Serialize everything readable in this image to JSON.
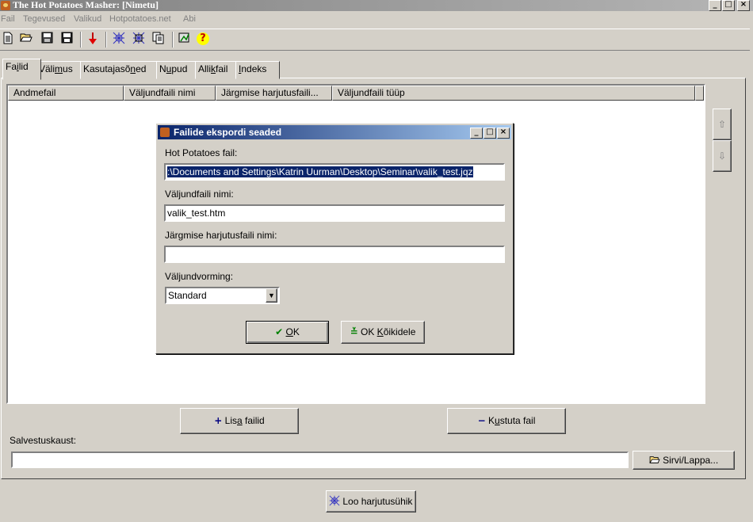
{
  "window": {
    "title": "The Hot Potatoes Masher: [Nimetu]",
    "min": "_",
    "max": "□",
    "close": "×"
  },
  "menu": [
    "Fail",
    "Tegevused",
    "Valikud",
    "Hotpotatoes.net",
    "Abi"
  ],
  "toolbar": {
    "icons": [
      "new-file-icon",
      "open-folder-icon",
      "save-icon",
      "save-as-icon",
      "down-arrow-icon",
      "web-icon",
      "web-options-icon",
      "copy-icon",
      "clock-icon",
      "help-icon"
    ],
    "help_glyph": "?"
  },
  "tabs": [
    {
      "pre": "Fa",
      "u": "i",
      "post": "lid"
    },
    {
      "pre": "Väli",
      "u": "m",
      "post": "us"
    },
    {
      "pre": "Kasutajasõ",
      "u": "n",
      "post": "ed"
    },
    {
      "pre": "N",
      "u": "u",
      "post": "pud"
    },
    {
      "pre": "Alli",
      "u": "k",
      "post": "fail"
    },
    {
      "pre": "",
      "u": "I",
      "post": "ndeks"
    }
  ],
  "table": {
    "columns": [
      "Andmefail",
      "Väljundfaili nimi",
      "Järgmise harjutusfaili...",
      "Väljundfaili tüüp"
    ]
  },
  "side": {
    "up": "⇧",
    "down": "⇩"
  },
  "buttons": {
    "add_pre": "Lis",
    "add_u": "a",
    "add_post": " failid",
    "delete_pre": "K",
    "delete_u": "u",
    "delete_post": "stuta fail",
    "browse": "Sirvi/Lappa...",
    "build_pre": "Loo har",
    "build_u": "j",
    "build_post": "utusühik"
  },
  "save_folder": {
    "label": "Salvestuskaust:",
    "value": ""
  },
  "dialog": {
    "title": "Failide ekspordi seaded",
    "hp_label": "Hot Potatoes fail:",
    "hp_value": ":\\Documents and Settings\\Katrin Uurman\\Desktop\\Seminar\\valik_test.jqz",
    "out_label": "Väljundfaili nimi:",
    "out_value": "valik_test.htm",
    "next_pre": "Jär",
    "next_u": "g",
    "next_post": "mise harjutusfaili nimi:",
    "next_value": "",
    "format_label": "Väljundvorming:",
    "format_value": "Standard",
    "ok_u": "O",
    "ok_post": "K",
    "okall_pre": "OK ",
    "okall_u": "K",
    "okall_post": "õikidele"
  }
}
